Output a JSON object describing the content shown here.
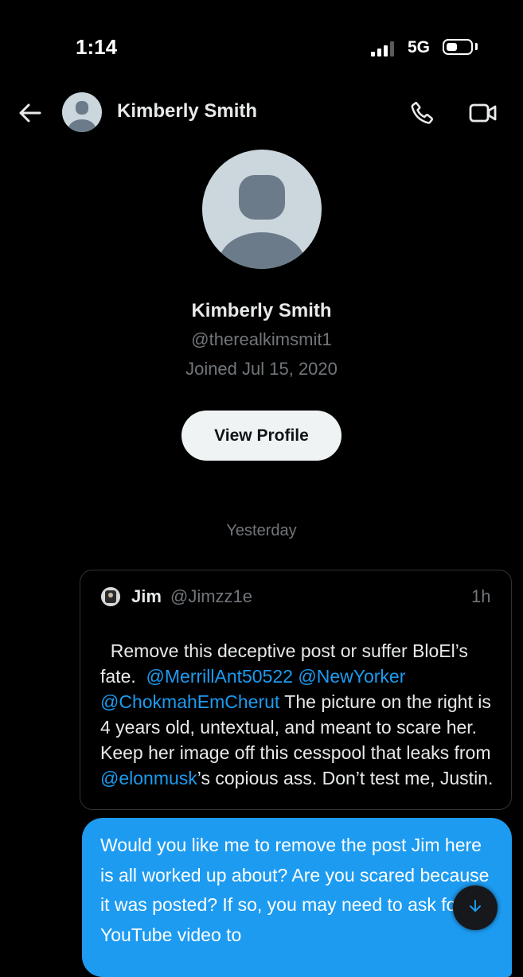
{
  "status_bar": {
    "time": "1:14",
    "network": "5G",
    "signal_bars_active": 3,
    "battery_icon": "battery-icon"
  },
  "header": {
    "back_icon": "back-arrow-icon",
    "contact_name": "Kimberly Smith",
    "call_icon": "phone-icon",
    "video_icon": "video-camera-icon"
  },
  "profile": {
    "name": "Kimberly Smith",
    "handle": "@therealkimsmit1",
    "joined": "Joined Jul 15, 2020",
    "view_button_label": "View Profile"
  },
  "conversation": {
    "date_separator": "Yesterday",
    "quoted_tweet": {
      "author_name": "Jim",
      "author_handle": "@Jimzz1e",
      "time": "1h",
      "text_parts": [
        {
          "text": "Remove this deceptive post or suffer BloEl’s fate.  ",
          "type": "text"
        },
        {
          "text": "@MerrillAnt50522",
          "type": "mention"
        },
        {
          "text": " ",
          "type": "text"
        },
        {
          "text": "@NewYorker",
          "type": "mention"
        },
        {
          "text": " ",
          "type": "text"
        },
        {
          "text": "@ChokmahEmCherut",
          "type": "mention"
        },
        {
          "text": " The picture on the right is 4 years old, untextual, and meant to scare her.  Keep her image off this cesspool that leaks from ",
          "type": "text"
        },
        {
          "text": "@elonmusk",
          "type": "mention"
        },
        {
          "text": "’s copious ass. Don’t test me, Justin.",
          "type": "text"
        }
      ]
    },
    "sent_message": "Would you like me to remove the post Jim here is all worked up about? Are you scared because it was posted? If so, you may need to ask for the YouTube video to"
  },
  "scroll_button": {
    "icon": "arrow-down-icon"
  },
  "colors": {
    "background": "#000000",
    "accent": "#1d9bf0",
    "secondary_text": "#71767b",
    "primary_text": "#e7e9ea"
  }
}
